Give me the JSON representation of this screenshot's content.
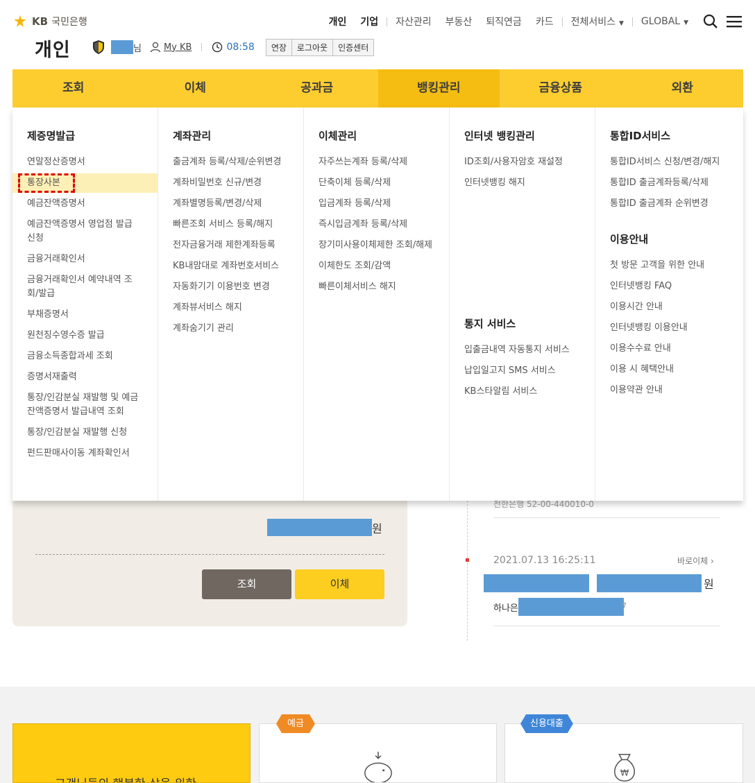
{
  "brand": {
    "logo_kb": "KB",
    "logo_bank": "국민은행",
    "section": "개인"
  },
  "topnav": {
    "personal": "개인",
    "corporate": "기업",
    "asset": "자산관리",
    "realestate": "부동산",
    "pension": "퇴직연금",
    "card": "카드",
    "all_services": "전체서비스",
    "global": "GLOBAL"
  },
  "user": {
    "name_suffix": "고객님",
    "name_suffix_visible": "님",
    "mykb": "My KB",
    "timer": "08:58",
    "extend": "연장",
    "logout": "로그아웃",
    "cert": "인증센터"
  },
  "gnb": [
    "조회",
    "이체",
    "공과금",
    "뱅킹관리",
    "금융상품",
    "외환"
  ],
  "gnb_active": "뱅킹관리",
  "mega": {
    "col1": {
      "title": "제증명발급",
      "items": [
        "연말정산증명서",
        "통장사본",
        "예금잔액증명서",
        "예금잔액증명서 영업점 발급\n신청",
        "금융거래확인서",
        "금융거래확인서 예약내역 조\n회/발급",
        "부채증명서",
        "원천징수영수증 발급",
        "금융소득종합과세 조회",
        "증명서재출력",
        "통장/인감분실 재발행 및 예금\n잔액증명서 발급내역 조회",
        "통장/인감분실 재발행 신청",
        "펀드판매사이동 계좌확인서"
      ]
    },
    "col2": {
      "title": "계좌관리",
      "items": [
        "출금계좌 등록/삭제/순위변경",
        "계좌비밀번호 신규/변경",
        "계좌별명등록/변경/삭제",
        "빠른조회 서비스 등록/해지",
        "전자금융거래 제한계좌등록",
        "KB내맘대로 계좌번호서비스",
        "자동화기기 이용번호 변경",
        "계좌뷰서비스 해지",
        "계좌숨기기 관리"
      ]
    },
    "col3": {
      "title": "이체관리",
      "items": [
        "자주쓰는계좌 등록/삭제",
        "단축이체 등록/삭제",
        "입금계좌 등록/삭제",
        "즉시입금계좌 등록/삭제",
        "장기미사용이체제한 조회/해제",
        "이체한도 조회/감액",
        "빠른이체서비스 해지"
      ]
    },
    "col4": {
      "title": "인터넷 뱅킹관리",
      "items": [
        "ID조회/사용자암호 재설정",
        "인터넷뱅킹 해지"
      ],
      "title2": "통지 서비스",
      "items2": [
        "입출금내역 자동통지 서비스",
        "납입일고지 SMS 서비스",
        "KB스타알림 서비스"
      ]
    },
    "col5": {
      "title": "통합ID서비스",
      "items": [
        "통합ID서비스 신청/변경/해지",
        "통합ID 출금계좌등록/삭제",
        "통합ID 출금계좌 순위변경"
      ],
      "title2": "이용안내",
      "items2": [
        "첫 방문 고객을 위한 안내",
        "인터넷뱅킹 FAQ",
        "이용시간 안내",
        "인터넷뱅킹 이용안내",
        "이용수수료 안내",
        "이용 시 혜택안내",
        "이용약관 안내"
      ]
    }
  },
  "account_panel": {
    "amount_unit": "원",
    "query_button": "조회",
    "transfer_button": "이체"
  },
  "history": {
    "partial_text": "전한은행 52-00-440010-0",
    "datetime": "2021.07.13 16:25:11",
    "quick_transfer": "바로이체",
    "amount_unit": "원",
    "bank_prefix": "하나은",
    "bank_suffix": "7"
  },
  "bottom": {
    "promo_text": "고객님들의 행복한 삶을 위한",
    "tag_deposit": "예금",
    "tag_loan": "신용대출"
  },
  "colors": {
    "gnb": "#fdcd30",
    "gnb_active": "#f5bd12",
    "highlight": "#fdf0b6",
    "mask": "#5b9bd5"
  }
}
